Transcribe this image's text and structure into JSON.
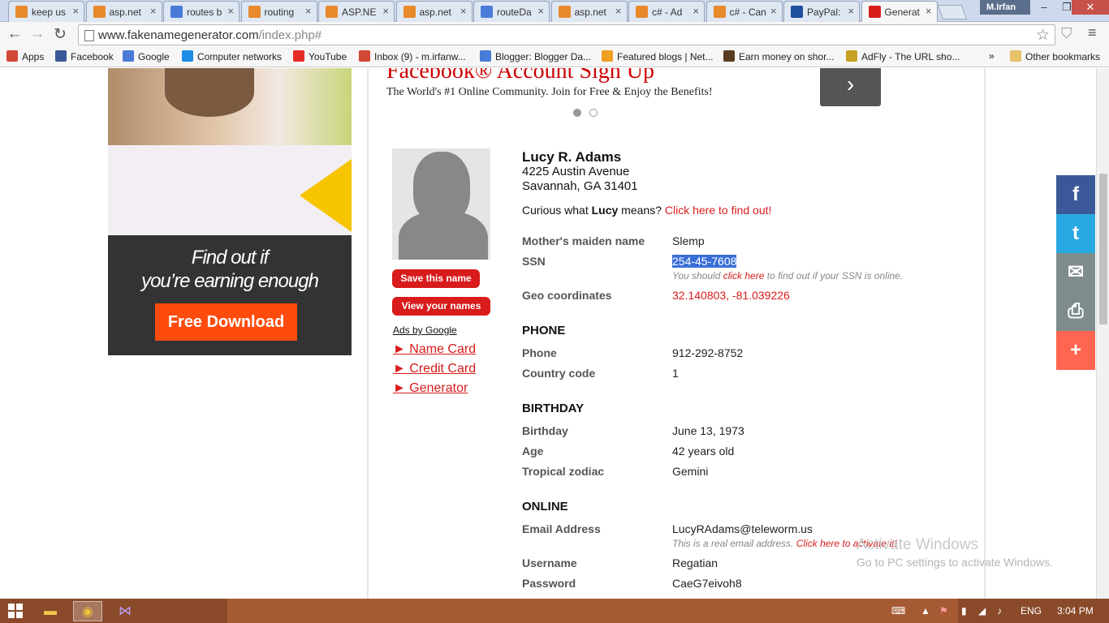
{
  "tabs": [
    {
      "label": "keep us",
      "icon": "stack-icon",
      "color": "#e8892c",
      "active": false
    },
    {
      "label": "asp.net",
      "icon": "stack-icon",
      "color": "#e8892c",
      "active": false
    },
    {
      "label": "routes b",
      "icon": "google-icon",
      "color": "#4a7bd8",
      "active": false
    },
    {
      "label": "routing",
      "icon": "stack-icon",
      "color": "#e8892c",
      "active": false
    },
    {
      "label": "ASP.NE",
      "icon": "stack-icon",
      "color": "#e8892c",
      "active": false
    },
    {
      "label": "asp.net",
      "icon": "stack-icon",
      "color": "#e8892c",
      "active": false
    },
    {
      "label": "routeDa",
      "icon": "google-icon",
      "color": "#4a7bd8",
      "active": false
    },
    {
      "label": "asp.net",
      "icon": "stack-icon",
      "color": "#e8892c",
      "active": false
    },
    {
      "label": "c# - Ad",
      "icon": "stack-icon",
      "color": "#e8892c",
      "active": false
    },
    {
      "label": "c# - Can",
      "icon": "stack-icon",
      "color": "#e8892c",
      "active": false
    },
    {
      "label": "PayPal:",
      "icon": "paypal-icon",
      "color": "#1d4f9e",
      "active": false
    },
    {
      "label": "Generat",
      "icon": "fakename-icon",
      "color": "#d81b1b",
      "active": true
    }
  ],
  "profile": "M.Irfan",
  "url": {
    "host": "www.fakenamegenerator.com",
    "path": "/index.php#"
  },
  "bookmarks": [
    {
      "label": "Apps",
      "icon": "apps-icon",
      "color": "#d14836"
    },
    {
      "label": "Facebook",
      "icon": "facebook-icon",
      "color": "#3b5998"
    },
    {
      "label": "Google",
      "icon": "google-icon",
      "color": "#4a7bd8"
    },
    {
      "label": "Computer networks",
      "icon": "dropbox-icon",
      "color": "#1f8ce6"
    },
    {
      "label": "YouTube",
      "icon": "youtube-icon",
      "color": "#e52d27"
    },
    {
      "label": "Inbox (9) - m.irfanw...",
      "icon": "gmail-icon",
      "color": "#d14836"
    },
    {
      "label": "Blogger: Blogger Da...",
      "icon": "google-icon",
      "color": "#4a7bd8"
    },
    {
      "label": "Featured blogs | Net...",
      "icon": "globe-icon",
      "color": "#f0a020"
    },
    {
      "label": "Earn money on shor...",
      "icon": "adfly-icon",
      "color": "#5a3b20"
    },
    {
      "label": "AdFly - The URL sho...",
      "icon": "bee-icon",
      "color": "#c8a020"
    }
  ],
  "bookmarks_more": "»",
  "other_bookmarks": "Other bookmarks",
  "ad_left": {
    "line1": "Find out if",
    "line2": "you’re earning enough",
    "button": "Free Download"
  },
  "fb_ad": {
    "title": "Facebook® Account Sign Up",
    "subtitle": "The World's #1 Online Community. Join for Free & Enjoy the Benefits!",
    "next_icon": "›"
  },
  "sidebar": {
    "save_button": "Save this name",
    "view_button": "View your names",
    "ads_label": "Ads by Google",
    "links": [
      "► Name Card",
      "► Credit Card",
      "► Generator"
    ]
  },
  "person": {
    "name": "Lucy R. Adams",
    "address1": "4225 Austin Avenue",
    "address2": "Savannah, GA 31401",
    "curious_pre": "Curious what ",
    "curious_name": "Lucy",
    "curious_mid": " means? ",
    "curious_link": "Click here to find out!"
  },
  "details": {
    "maiden_label": "Mother's maiden name",
    "maiden_value": "Slemp",
    "ssn_label": "SSN",
    "ssn_value": "254-45-7608",
    "ssn_note_pre": "You should ",
    "ssn_note_link": "click here",
    "ssn_note_post": " to find out if your SSN is online.",
    "geo_label": "Geo coordinates",
    "geo_value": "32.140803, -81.039226"
  },
  "phone": {
    "heading": "PHONE",
    "phone_label": "Phone",
    "phone_value": "912-292-8752",
    "cc_label": "Country code",
    "cc_value": "1"
  },
  "birthday": {
    "heading": "BIRTHDAY",
    "bday_label": "Birthday",
    "bday_value": "June 13, 1973",
    "age_label": "Age",
    "age_value": "42 years old",
    "zodiac_label": "Tropical zodiac",
    "zodiac_value": "Gemini"
  },
  "online": {
    "heading": "ONLINE",
    "email_label": "Email Address",
    "email_value": "LucyRAdams@teleworm.us",
    "email_note_pre": "This is a real email address. ",
    "email_note_link": "Click here to activate it!",
    "user_label": "Username",
    "user_value": "Regatian",
    "pass_label": "Password",
    "pass_value": "CaeG7eivoh8"
  },
  "watermark": {
    "line1": "Activate Windows",
    "line2": "Go to PC settings to activate Windows."
  },
  "share": [
    {
      "icon": "facebook-icon",
      "glyph": "f",
      "color": "#3b5998"
    },
    {
      "icon": "twitter-icon",
      "glyph": "t",
      "color": "#29a9e1"
    },
    {
      "icon": "mail-icon",
      "glyph": "✉",
      "color": "#7f8c8d"
    },
    {
      "icon": "print-icon",
      "glyph": "⎙",
      "color": "#7f8c8d"
    },
    {
      "icon": "plus-icon",
      "glyph": "+",
      "color": "#ff6550"
    }
  ],
  "taskbar": {
    "lang": "ENG",
    "time": "3:04 PM"
  }
}
